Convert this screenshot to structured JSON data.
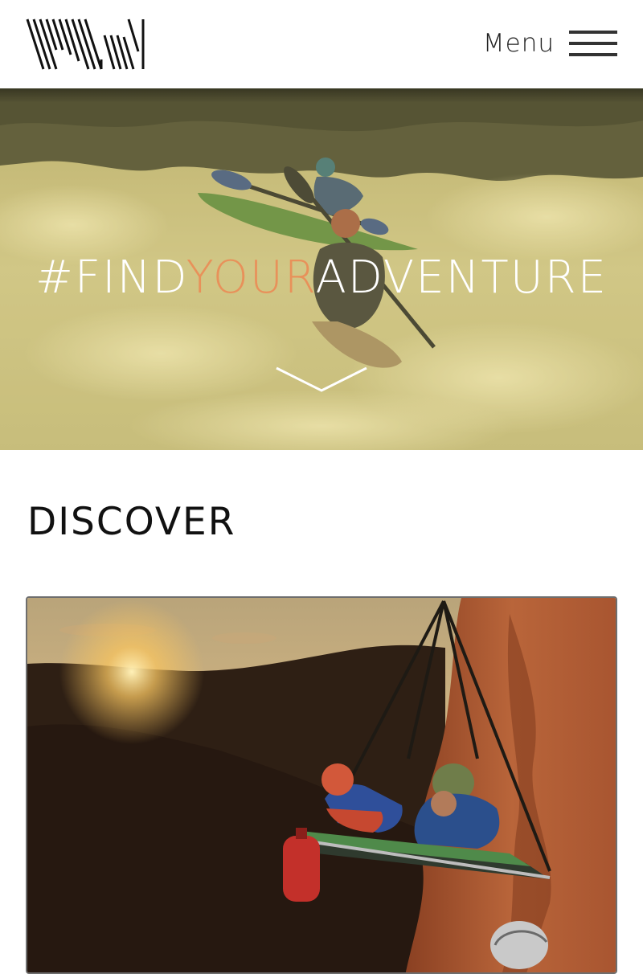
{
  "header": {
    "logo_icon": "wni-striped-logo",
    "menu_label": "Menu",
    "menu_icon": "hamburger-icon"
  },
  "hero": {
    "title_prefix": "#FIND",
    "title_accent": "YOUR",
    "title_suffix": "ADVENTURE",
    "accent_color": "#e8915a",
    "scroll_icon": "chevron-down-icon",
    "image": "whitewater-kayakers"
  },
  "discover": {
    "title": "DISCOVER",
    "card_image": "portaledge-climbers-sunset"
  }
}
